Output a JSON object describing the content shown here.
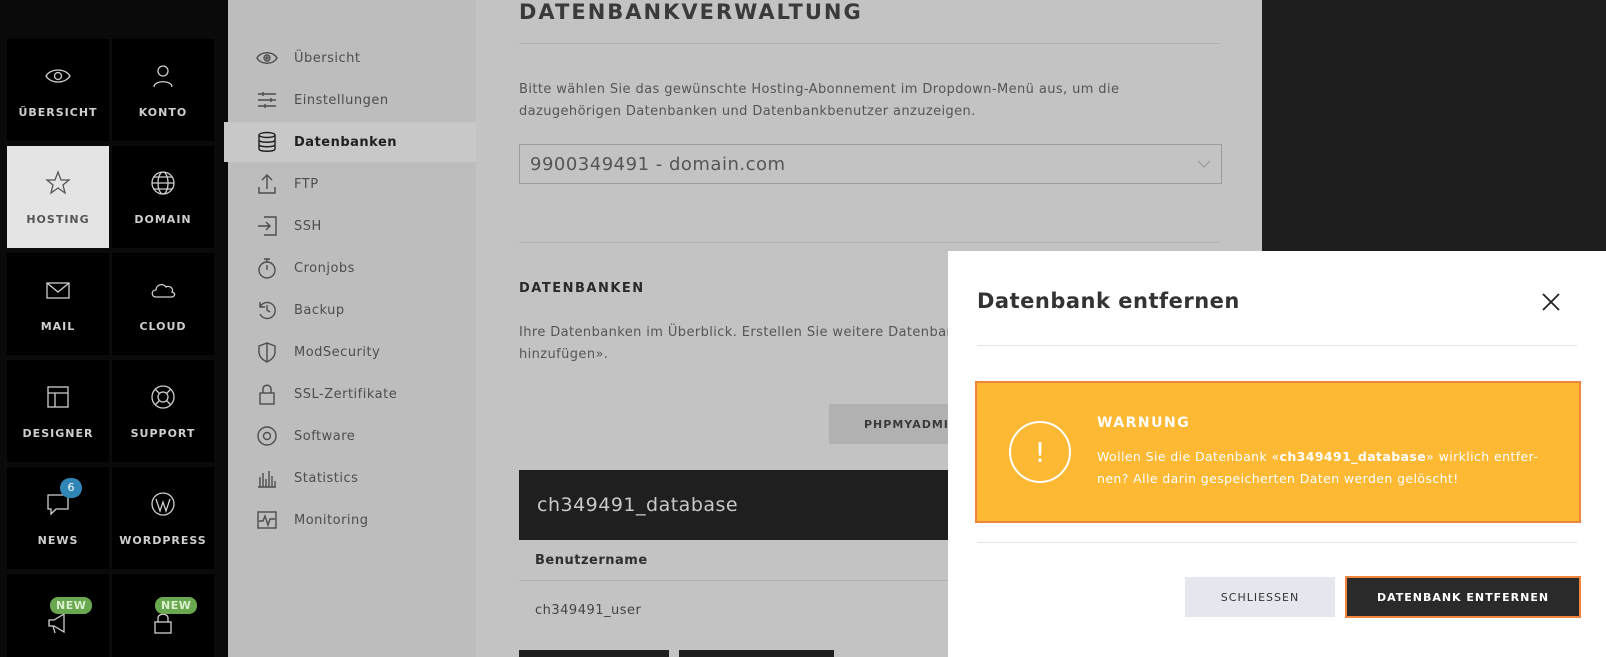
{
  "tilenav": {
    "tiles": [
      {
        "label": "ÜBERSICHT",
        "icon": "eye-icon"
      },
      {
        "label": "KONTO",
        "icon": "user-icon"
      },
      {
        "label": "HOSTING",
        "icon": "star-icon",
        "active": true
      },
      {
        "label": "DOMAIN",
        "icon": "globe-icon"
      },
      {
        "label": "MAIL",
        "icon": "mail-icon"
      },
      {
        "label": "CLOUD",
        "icon": "cloud-icon"
      },
      {
        "label": "DESIGNER",
        "icon": "layout-icon"
      },
      {
        "label": "SUPPORT",
        "icon": "lifebuoy-icon"
      },
      {
        "label": "NEWS",
        "icon": "chat-icon",
        "badge": "6"
      },
      {
        "label": "WORDPRESS",
        "icon": "wordpress-icon"
      },
      {
        "label": "",
        "icon": "megaphone-icon",
        "badge": "NEW"
      },
      {
        "label": "",
        "icon": "lock-icon",
        "badge": "NEW"
      }
    ]
  },
  "subnav": {
    "items": [
      {
        "label": "Übersicht",
        "icon": "eye-icon"
      },
      {
        "label": "Einstellungen",
        "icon": "sliders-icon"
      },
      {
        "label": "Datenbanken",
        "icon": "database-icon",
        "active": true
      },
      {
        "label": "FTP",
        "icon": "upload-icon"
      },
      {
        "label": "SSH",
        "icon": "login-icon"
      },
      {
        "label": "Cronjobs",
        "icon": "stopwatch-icon"
      },
      {
        "label": "Backup",
        "icon": "history-icon"
      },
      {
        "label": "ModSecurity",
        "icon": "shield-icon"
      },
      {
        "label": "SSL-Zertifikate",
        "icon": "lock-icon"
      },
      {
        "label": "Software",
        "icon": "disc-icon"
      },
      {
        "label": "Statistics",
        "icon": "bar-chart-icon"
      },
      {
        "label": "Monitoring",
        "icon": "pulse-icon"
      }
    ]
  },
  "main": {
    "title": "DATENBANKVERWALTUNG",
    "intro": "Bitte wählen Sie das gewünschte Hosting-Abonnement im Dropdown-Menü aus, um die dazugehörigen Datenbanken und Datenbankbenutzer anzuzeigen.",
    "select_value": "9900349491 - domain.com",
    "section_title": "DATENBANKEN",
    "section_text": "Ihre Datenbanken im Überblick. Erstellen Sie weitere Datenban hinzufügen».",
    "phpmyadmin_label": "PHPMYADMIN",
    "db_name": "ch349491_database",
    "col_username": "Benutzername",
    "row_username": "ch349491_user"
  },
  "modal": {
    "title": "Datenbank entfernen",
    "warning_title": "WARNUNG",
    "warning_pre": "Wollen Sie die Datenbank «",
    "warning_db": "ch349491_database",
    "warning_post": "» wirklich entfer-nen? Alle darin gespeicherten Daten werden gelöscht!",
    "close_label": "SCHLIESSEN",
    "remove_label": "DATENBANK ENTFERNEN"
  },
  "colors": {
    "warning_bg": "#fdb933",
    "warning_border": "#f0853b",
    "badge_blue": "#2f86b6",
    "badge_green": "#69a84f"
  }
}
